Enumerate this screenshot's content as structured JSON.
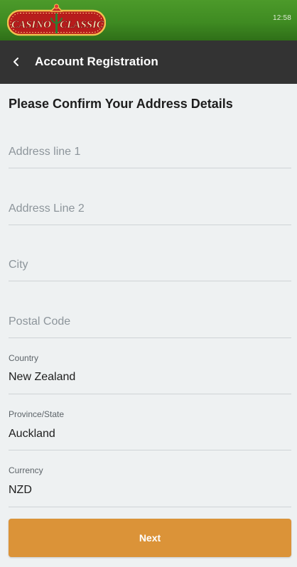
{
  "header": {
    "logo_text_left": "CASINO",
    "logo_text_right": "CLASSIC",
    "time": "12:58"
  },
  "nav": {
    "title": "Account Registration"
  },
  "form": {
    "heading": "Please Confirm Your Address Details",
    "address1": {
      "value": "",
      "placeholder": "Address line 1"
    },
    "address2": {
      "value": "",
      "placeholder": "Address Line 2"
    },
    "city": {
      "value": "",
      "placeholder": "City"
    },
    "postal": {
      "value": "",
      "placeholder": "Postal Code"
    },
    "country": {
      "label": "Country",
      "value": "New Zealand"
    },
    "province": {
      "label": "Province/State",
      "value": "Auckland"
    },
    "currency": {
      "label": "Currency",
      "value": "NZD"
    },
    "next_label": "Next"
  },
  "colors": {
    "header_green": "#3f8b22",
    "navbar": "#333333",
    "background": "#eef1f2",
    "button": "#db9338"
  }
}
